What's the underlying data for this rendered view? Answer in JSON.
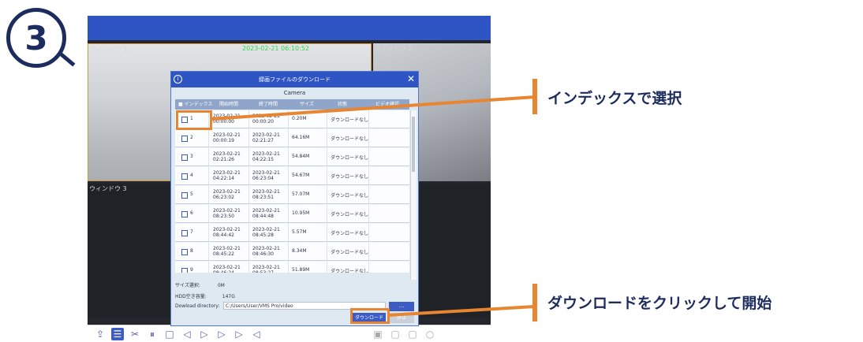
{
  "step_number": "3",
  "app": {
    "pane_labels": [
      "ウィンドウ 1",
      "ウィンドウ 2",
      "ウィンドウ 3"
    ],
    "timestamp": "2023-02-21 06:10:52"
  },
  "dialog": {
    "title": "録画ファイルのダウンロード",
    "close": "✕",
    "info": "i",
    "camera": "Camera",
    "columns": [
      "■ インデックス",
      "開始時間",
      "終了時間",
      "サイズ",
      "状態",
      "ビデオ確認"
    ],
    "rows": [
      {
        "index": "1",
        "start": [
          "2023-02-21",
          "00:00:00"
        ],
        "end": [
          "2023-02-21",
          "00:00:20"
        ],
        "size": "0.20M",
        "status": "ダウンロードなし"
      },
      {
        "index": "2",
        "start": [
          "2023-02-21",
          "00:00:19"
        ],
        "end": [
          "2023-02-21",
          "02:21:27"
        ],
        "size": "64.16M",
        "status": "ダウンロードなし"
      },
      {
        "index": "3",
        "start": [
          "2023-02-21",
          "02:21:26"
        ],
        "end": [
          "2023-02-21",
          "04:22:15"
        ],
        "size": "54.84M",
        "status": "ダウンロードなし"
      },
      {
        "index": "4",
        "start": [
          "2023-02-21",
          "04:22:14"
        ],
        "end": [
          "2023-02-21",
          "06:23:04"
        ],
        "size": "54.67M",
        "status": "ダウンロードなし"
      },
      {
        "index": "5",
        "start": [
          "2023-02-21",
          "06:23:02"
        ],
        "end": [
          "2023-02-21",
          "08:23:51"
        ],
        "size": "57.07M",
        "status": "ダウンロードなし"
      },
      {
        "index": "6",
        "start": [
          "2023-02-21",
          "08:23:50"
        ],
        "end": [
          "2023-02-21",
          "08:44:48"
        ],
        "size": "10.95M",
        "status": "ダウンロードなし"
      },
      {
        "index": "7",
        "start": [
          "2023-02-21",
          "08:44:42"
        ],
        "end": [
          "2023-02-21",
          "08:45:28"
        ],
        "size": "5.57M",
        "status": "ダウンロードなし"
      },
      {
        "index": "8",
        "start": [
          "2023-02-21",
          "08:45:22"
        ],
        "end": [
          "2023-02-21",
          "08:46:30"
        ],
        "size": "8.34M",
        "status": "ダウンロードなし"
      },
      {
        "index": "9",
        "start": [
          "2023-02-21",
          "08:46:24"
        ],
        "end": [
          "2023-02-21",
          "08:53:27"
        ],
        "size": "51.89M",
        "status": "ダウンロードなし"
      }
    ],
    "selected_size_label": "サイズ選択:",
    "selected_size_value": "0M",
    "hdd_label": "HDD空き容量:",
    "hdd_value": "147G",
    "dir_label": "Dowload directory:",
    "dir_value": "C:/Users/User/VMS Pro/video",
    "more_button": "...",
    "download_button": "ダウンロード",
    "stop_button": "停止"
  },
  "callouts": {
    "select": "インデックスで選択",
    "start": "ダウンロードをクリックして開始"
  },
  "colors": {
    "navy": "#1d2c5e",
    "orange": "#e88531",
    "accent": "#2f55c5"
  }
}
